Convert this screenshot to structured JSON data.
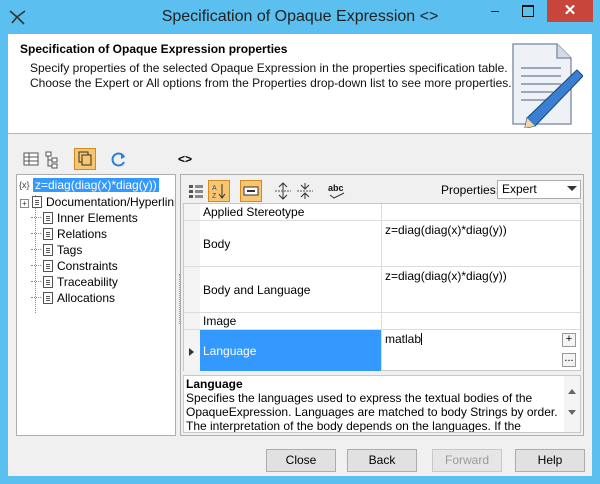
{
  "window": {
    "title": "Specification of Opaque Expression <>"
  },
  "header": {
    "title": "Specification of Opaque Expression properties",
    "line1": "Specify properties of the selected Opaque Expression in the properties specification table.",
    "line2": "Choose the Expert or All options from the Properties drop-down list to see more properties."
  },
  "element_label": "<>",
  "tree": {
    "root_icon": "{x}",
    "root": "z=diag(diag(x)*diag(y))",
    "items": [
      "Documentation/Hyperlinks",
      "Inner Elements",
      "Relations",
      "Tags",
      "Constraints",
      "Traceability",
      "Allocations"
    ]
  },
  "properties": {
    "label": "Properties:",
    "selected": "Expert"
  },
  "grid": {
    "rows": [
      {
        "name": "Applied Stereotype",
        "value": ""
      },
      {
        "name": "Body",
        "value": "z=diag(diag(x)*diag(y))"
      },
      {
        "name": "Body and Language",
        "value": "z=diag(diag(x)*diag(y))"
      },
      {
        "name": "Image",
        "value": ""
      },
      {
        "name": "Language",
        "value": "matlab"
      }
    ]
  },
  "description": {
    "title": "Language",
    "text": "Specifies the languages used to express the textual bodies of the OpaqueExpression.  Languages are matched to body Strings by order. The interpretation of the body depends on the languages. If the languages are"
  },
  "buttons": {
    "close": "Close",
    "back": "Back",
    "forward": "Forward",
    "help": "Help"
  },
  "mini_buttons": {
    "add": "+",
    "more": "..."
  },
  "title_buttons": {
    "minimize": "–",
    "close": "✕"
  },
  "colors": {
    "titlebar": "#5bc0f0",
    "selection": "#3399ff",
    "close": "#c7453b",
    "active_tool": "#f7c66e"
  }
}
